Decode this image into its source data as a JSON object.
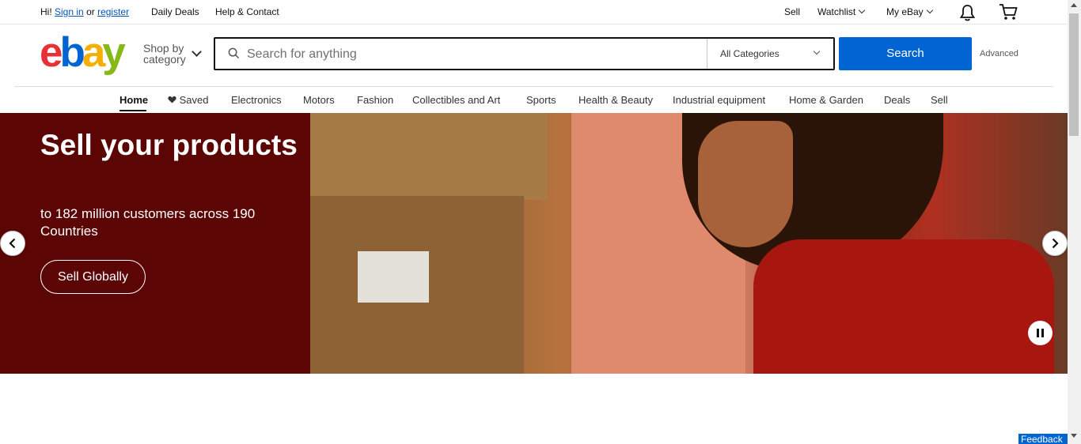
{
  "topbar": {
    "greeting": "Hi!",
    "sign_in": "Sign in",
    "or": "or",
    "register": "register",
    "daily_deals": "Daily Deals",
    "help_contact": "Help & Contact",
    "sell": "Sell",
    "watchlist": "Watchlist",
    "my_ebay": "My eBay"
  },
  "header": {
    "logo_letters": [
      "e",
      "b",
      "a",
      "y"
    ],
    "logo_colors": [
      "#e53238",
      "#0064d2",
      "#f5af02",
      "#86b817"
    ],
    "shop_by_line1": "Shop by",
    "shop_by_line2": "category",
    "search_placeholder": "Search for anything",
    "category_selected": "All Categories",
    "search_button": "Search",
    "advanced": "Advanced"
  },
  "nav": {
    "items": [
      "Home",
      "Saved",
      "Electronics",
      "Motors",
      "Fashion",
      "Collectibles and Art",
      "Sports",
      "Health & Beauty",
      "Industrial equipment",
      "Home & Garden",
      "Deals",
      "Sell"
    ]
  },
  "hero": {
    "title": "Sell your products",
    "subtitle": "to 182 million customers across 190 Countries",
    "cta": "Sell Globally",
    "bg_color": "#5b0505"
  },
  "feedback": "Feedback",
  "accent_color": "#0064d2"
}
